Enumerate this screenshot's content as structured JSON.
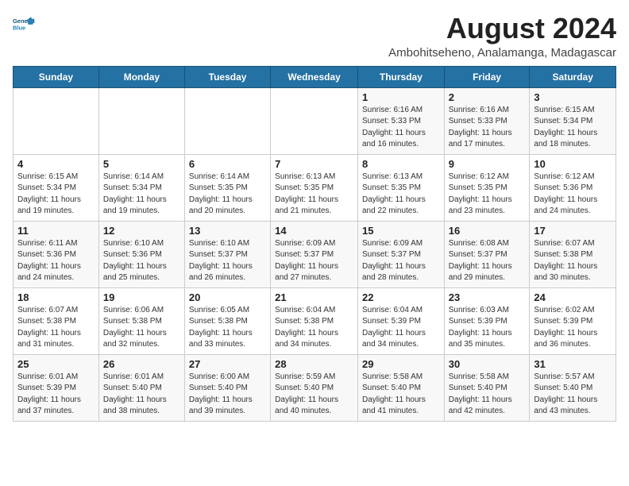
{
  "logo": {
    "line1": "General",
    "line2": "Blue"
  },
  "title": {
    "month_year": "August 2024",
    "location": "Ambohitseheno, Analamanga, Madagascar"
  },
  "header": {
    "days": [
      "Sunday",
      "Monday",
      "Tuesday",
      "Wednesday",
      "Thursday",
      "Friday",
      "Saturday"
    ]
  },
  "weeks": [
    {
      "cells": [
        {
          "day": "",
          "info": ""
        },
        {
          "day": "",
          "info": ""
        },
        {
          "day": "",
          "info": ""
        },
        {
          "day": "",
          "info": ""
        },
        {
          "day": "1",
          "info": "Sunrise: 6:16 AM\nSunset: 5:33 PM\nDaylight: 11 hours\nand 16 minutes."
        },
        {
          "day": "2",
          "info": "Sunrise: 6:16 AM\nSunset: 5:33 PM\nDaylight: 11 hours\nand 17 minutes."
        },
        {
          "day": "3",
          "info": "Sunrise: 6:15 AM\nSunset: 5:34 PM\nDaylight: 11 hours\nand 18 minutes."
        }
      ]
    },
    {
      "cells": [
        {
          "day": "4",
          "info": "Sunrise: 6:15 AM\nSunset: 5:34 PM\nDaylight: 11 hours\nand 19 minutes."
        },
        {
          "day": "5",
          "info": "Sunrise: 6:14 AM\nSunset: 5:34 PM\nDaylight: 11 hours\nand 19 minutes."
        },
        {
          "day": "6",
          "info": "Sunrise: 6:14 AM\nSunset: 5:35 PM\nDaylight: 11 hours\nand 20 minutes."
        },
        {
          "day": "7",
          "info": "Sunrise: 6:13 AM\nSunset: 5:35 PM\nDaylight: 11 hours\nand 21 minutes."
        },
        {
          "day": "8",
          "info": "Sunrise: 6:13 AM\nSunset: 5:35 PM\nDaylight: 11 hours\nand 22 minutes."
        },
        {
          "day": "9",
          "info": "Sunrise: 6:12 AM\nSunset: 5:35 PM\nDaylight: 11 hours\nand 23 minutes."
        },
        {
          "day": "10",
          "info": "Sunrise: 6:12 AM\nSunset: 5:36 PM\nDaylight: 11 hours\nand 24 minutes."
        }
      ]
    },
    {
      "cells": [
        {
          "day": "11",
          "info": "Sunrise: 6:11 AM\nSunset: 5:36 PM\nDaylight: 11 hours\nand 24 minutes."
        },
        {
          "day": "12",
          "info": "Sunrise: 6:10 AM\nSunset: 5:36 PM\nDaylight: 11 hours\nand 25 minutes."
        },
        {
          "day": "13",
          "info": "Sunrise: 6:10 AM\nSunset: 5:37 PM\nDaylight: 11 hours\nand 26 minutes."
        },
        {
          "day": "14",
          "info": "Sunrise: 6:09 AM\nSunset: 5:37 PM\nDaylight: 11 hours\nand 27 minutes."
        },
        {
          "day": "15",
          "info": "Sunrise: 6:09 AM\nSunset: 5:37 PM\nDaylight: 11 hours\nand 28 minutes."
        },
        {
          "day": "16",
          "info": "Sunrise: 6:08 AM\nSunset: 5:37 PM\nDaylight: 11 hours\nand 29 minutes."
        },
        {
          "day": "17",
          "info": "Sunrise: 6:07 AM\nSunset: 5:38 PM\nDaylight: 11 hours\nand 30 minutes."
        }
      ]
    },
    {
      "cells": [
        {
          "day": "18",
          "info": "Sunrise: 6:07 AM\nSunset: 5:38 PM\nDaylight: 11 hours\nand 31 minutes."
        },
        {
          "day": "19",
          "info": "Sunrise: 6:06 AM\nSunset: 5:38 PM\nDaylight: 11 hours\nand 32 minutes."
        },
        {
          "day": "20",
          "info": "Sunrise: 6:05 AM\nSunset: 5:38 PM\nDaylight: 11 hours\nand 33 minutes."
        },
        {
          "day": "21",
          "info": "Sunrise: 6:04 AM\nSunset: 5:38 PM\nDaylight: 11 hours\nand 34 minutes."
        },
        {
          "day": "22",
          "info": "Sunrise: 6:04 AM\nSunset: 5:39 PM\nDaylight: 11 hours\nand 34 minutes."
        },
        {
          "day": "23",
          "info": "Sunrise: 6:03 AM\nSunset: 5:39 PM\nDaylight: 11 hours\nand 35 minutes."
        },
        {
          "day": "24",
          "info": "Sunrise: 6:02 AM\nSunset: 5:39 PM\nDaylight: 11 hours\nand 36 minutes."
        }
      ]
    },
    {
      "cells": [
        {
          "day": "25",
          "info": "Sunrise: 6:01 AM\nSunset: 5:39 PM\nDaylight: 11 hours\nand 37 minutes."
        },
        {
          "day": "26",
          "info": "Sunrise: 6:01 AM\nSunset: 5:40 PM\nDaylight: 11 hours\nand 38 minutes."
        },
        {
          "day": "27",
          "info": "Sunrise: 6:00 AM\nSunset: 5:40 PM\nDaylight: 11 hours\nand 39 minutes."
        },
        {
          "day": "28",
          "info": "Sunrise: 5:59 AM\nSunset: 5:40 PM\nDaylight: 11 hours\nand 40 minutes."
        },
        {
          "day": "29",
          "info": "Sunrise: 5:58 AM\nSunset: 5:40 PM\nDaylight: 11 hours\nand 41 minutes."
        },
        {
          "day": "30",
          "info": "Sunrise: 5:58 AM\nSunset: 5:40 PM\nDaylight: 11 hours\nand 42 minutes."
        },
        {
          "day": "31",
          "info": "Sunrise: 5:57 AM\nSunset: 5:40 PM\nDaylight: 11 hours\nand 43 minutes."
        }
      ]
    }
  ]
}
